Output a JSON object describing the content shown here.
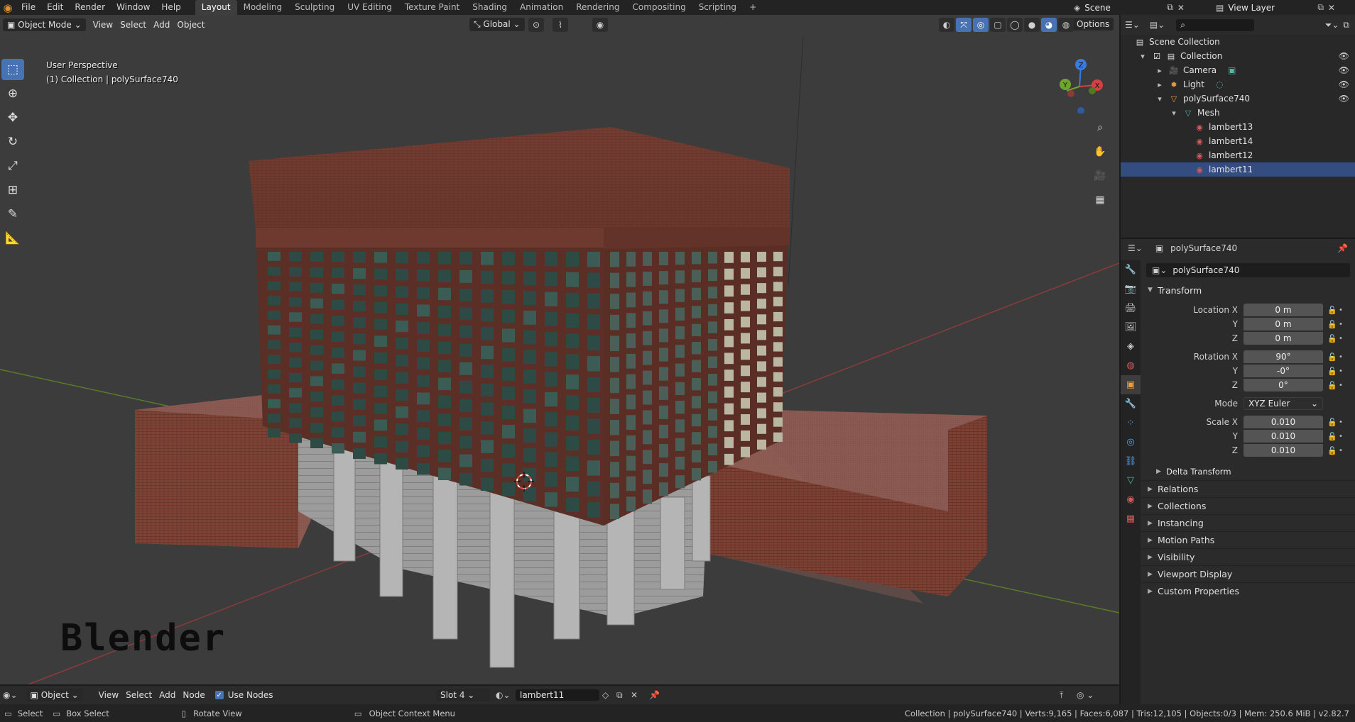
{
  "menu": [
    "File",
    "Edit",
    "Render",
    "Window",
    "Help"
  ],
  "workspaces": [
    "Layout",
    "Modeling",
    "Sculpting",
    "UV Editing",
    "Texture Paint",
    "Shading",
    "Animation",
    "Rendering",
    "Compositing",
    "Scripting"
  ],
  "active_workspace": "Layout",
  "add_tab": "+",
  "scene": {
    "name": "Scene",
    "view_layer": "View Layer"
  },
  "viewport": {
    "mode": "Object Mode",
    "menus": [
      "View",
      "Select",
      "Add",
      "Object"
    ],
    "orientation": "Global",
    "options": "Options",
    "perspective": "User Perspective",
    "collection_info": "(1) Collection | polySurface740",
    "watermark": "Blender",
    "gizmo": {
      "z": "Z",
      "y": "Y",
      "x": "X"
    }
  },
  "shader_header": {
    "editor_type": "Object",
    "menus": [
      "View",
      "Select",
      "Add",
      "Node"
    ],
    "use_nodes_label": "Use Nodes",
    "slot": "Slot 4",
    "material": "lambert11"
  },
  "status": {
    "select": "Select",
    "box_select": "Box Select",
    "rotate_view": "Rotate View",
    "context_menu": "Object Context Menu",
    "stats": "Collection | polySurface740 | Verts:9,165 | Faces:6,087 | Tris:12,105 | Objects:0/3 | Mem: 250.6 MiB | v2.82.7"
  },
  "outliner": {
    "rows": [
      {
        "label": "Scene Collection",
        "indent": 0,
        "icon": "scene-collection-icon"
      },
      {
        "label": "Collection",
        "indent": 1,
        "icon": "collection-icon"
      },
      {
        "label": "Camera",
        "indent": 2,
        "icon": "camera-icon"
      },
      {
        "label": "Light",
        "indent": 2,
        "icon": "light-icon"
      },
      {
        "label": "polySurface740",
        "indent": 2,
        "icon": "mesh-object-icon"
      },
      {
        "label": "Mesh",
        "indent": 3,
        "icon": "mesh-data-icon"
      },
      {
        "label": "lambert13",
        "indent": 4,
        "icon": "material-icon"
      },
      {
        "label": "lambert14",
        "indent": 4,
        "icon": "material-icon"
      },
      {
        "label": "lambert12",
        "indent": 4,
        "icon": "material-icon"
      },
      {
        "label": "lambert11",
        "indent": 4,
        "icon": "material-icon",
        "selected": true
      }
    ]
  },
  "properties": {
    "header_object": "polySurface740",
    "object_name": "polySurface740",
    "transform_title": "Transform",
    "location": {
      "label": "Location X",
      "x": "0 m",
      "y": "0 m",
      "z": "0 m"
    },
    "rotation": {
      "label": "Rotation X",
      "x": "90°",
      "y": "-0°",
      "z": "0°"
    },
    "mode_label": "Mode",
    "mode_value": "XYZ Euler",
    "scale": {
      "label": "Scale X",
      "x": "0.010",
      "y": "0.010",
      "z": "0.010"
    },
    "axis_y": "Y",
    "axis_z": "Z",
    "delta_transform": "Delta Transform",
    "panels": [
      "Relations",
      "Collections",
      "Instancing",
      "Motion Paths",
      "Visibility",
      "Viewport Display",
      "Custom Properties"
    ]
  },
  "colors": {
    "accent": "#4772b3",
    "selected_row": "#334d80",
    "brick": "#7a3c2e",
    "roof": "#6b3a2e",
    "window": "#2e4a45",
    "concrete": "#9a9a9a"
  }
}
